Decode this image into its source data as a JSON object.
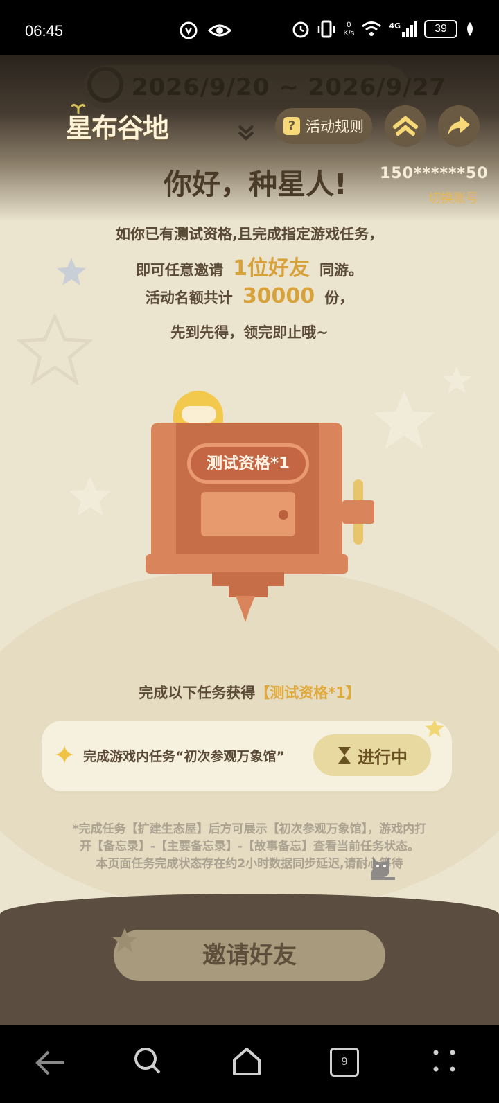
{
  "status_bar": {
    "time": "06:45",
    "net_speed_value": "0",
    "net_speed_unit": "K/s",
    "signal_label": "4G",
    "battery": "39"
  },
  "header": {
    "date_range": "2026/9/20 ~ 2026/9/27",
    "logo_text": "星布谷地",
    "rules_label": "活动规则",
    "greeting": "你好，种星人!",
    "account_masked": "150******50",
    "switch_account": "切换账号"
  },
  "description": {
    "line1": "如你已有测试资格,且完成指定游戏任务，",
    "line2_pre": "即可任意邀请",
    "line2_highlight": "1位好友",
    "line2_post": "同游。",
    "line3_pre": "活动名额共计",
    "line3_highlight": "30000",
    "line3_post": "份，",
    "line4": "先到先得，领完即止哦~"
  },
  "machine": {
    "label": "测试资格*1"
  },
  "task_section": {
    "title_pre": "完成以下任务获得",
    "title_reward": "【测试资格*1】",
    "task_text": "完成游戏内任务“初次参观万象馆”",
    "task_status": "进行中",
    "note_line1": "*完成任务【扩建生态屋】后方可展示【初次参观万象馆】，游戏内打",
    "note_line2": "开【备忘录】-【主要备忘录】-【故事备忘】查看当前任务状态。",
    "note_line3": "本页面任务完成状态存在约2小时数据同步延迟,请耐心等待"
  },
  "invite_button": "邀请好友",
  "nav_bar": {
    "tabs_count": "9"
  },
  "colors": {
    "background": "#ebe4cf",
    "accent_gold": "#d7a23a",
    "machine_orange": "#d9845a",
    "ground_brown": "#5b4d3f"
  }
}
